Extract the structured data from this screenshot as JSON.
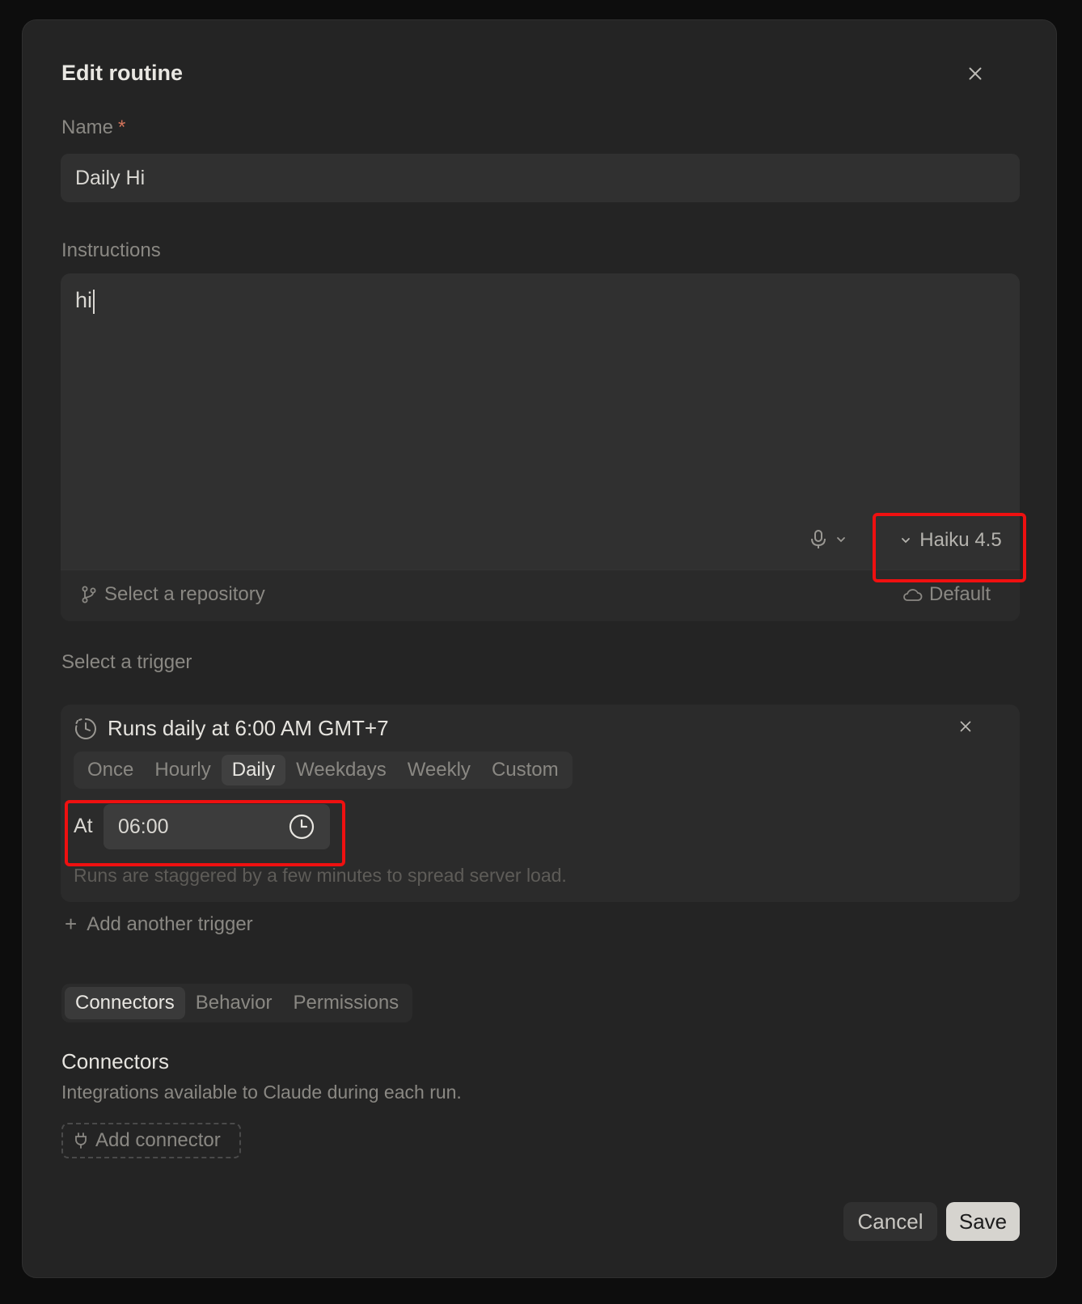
{
  "dialog": {
    "title": "Edit routine"
  },
  "name_field": {
    "label": "Name",
    "required_mark": "*",
    "value": "Daily Hi"
  },
  "instructions": {
    "label": "Instructions",
    "value": "hi",
    "model": "Haiku 4.5",
    "repository_placeholder": "Select a repository",
    "environment": "Default"
  },
  "trigger": {
    "label": "Select a trigger",
    "summary": "Runs daily at 6:00 AM GMT+7",
    "frequencies": [
      "Once",
      "Hourly",
      "Daily",
      "Weekdays",
      "Weekly",
      "Custom"
    ],
    "selected_frequency": "Daily",
    "at_label": "At",
    "time_value": "06:00",
    "hint": "Runs are staggered by a few minutes to spread server load.",
    "add_another": "Add another trigger"
  },
  "tabs": {
    "items": [
      "Connectors",
      "Behavior",
      "Permissions"
    ],
    "active": "Connectors"
  },
  "connectors": {
    "title": "Connectors",
    "subtitle": "Integrations available to Claude during each run.",
    "add_button": "Add connector"
  },
  "actions": {
    "cancel": "Cancel",
    "save": "Save"
  },
  "colors": {
    "highlight": "#ef1010",
    "dialog_bg": "#242424",
    "required": "#d2735a"
  }
}
